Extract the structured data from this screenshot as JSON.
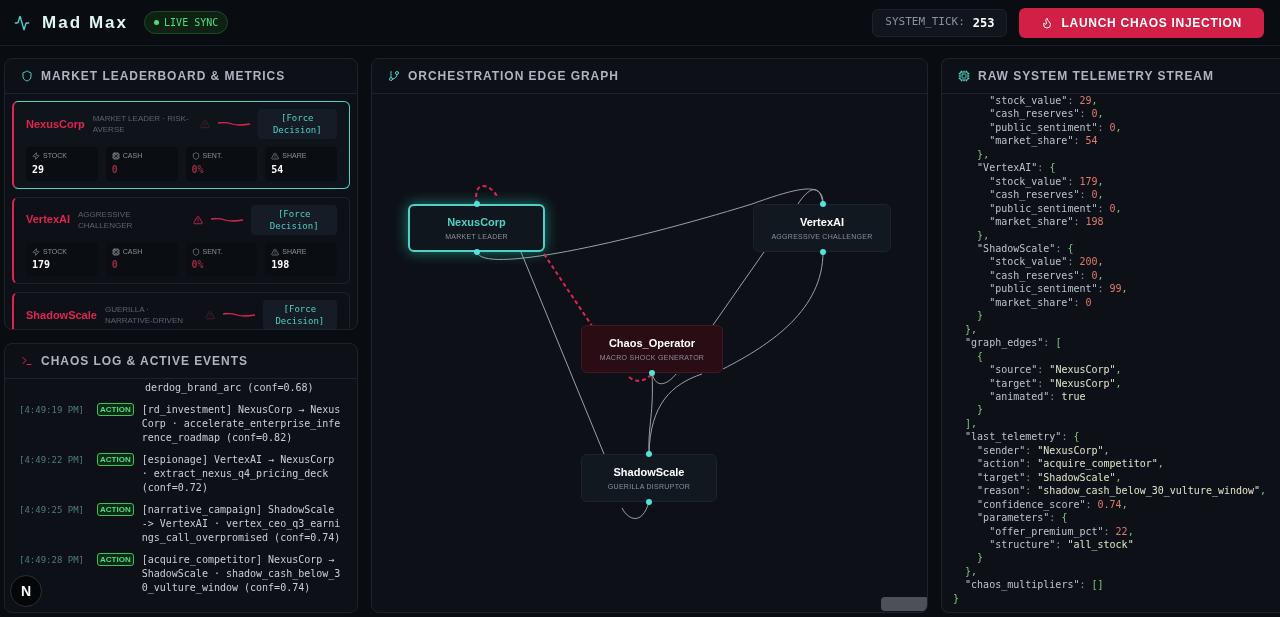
{
  "header": {
    "title": "Mad Max",
    "status": {
      "label": "LIVE SYNC",
      "live": true
    },
    "tick_label": "SYSTEM_TICK:",
    "tick_value": "253",
    "launch_button": "LAUNCH CHAOS INJECTION"
  },
  "leaderboard": {
    "title": "MARKET LEADERBOARD & METRICS",
    "cards": [
      {
        "name": "NexusCorp",
        "subtitle": "MARKET LEADER · RISK-AVERSE",
        "selected": true,
        "warning": false,
        "button": "[Force Decision]",
        "metrics": [
          {
            "kind": "stock",
            "label": "STOCK",
            "value": "29",
            "alert": false
          },
          {
            "kind": "cash",
            "label": "CASH",
            "value": "0",
            "alert": true
          },
          {
            "kind": "sentiment",
            "label": "SENT.",
            "value": "0%",
            "alert": true
          },
          {
            "kind": "share",
            "label": "SHARE",
            "value": "54",
            "alert": false
          }
        ]
      },
      {
        "name": "VertexAI",
        "subtitle": "AGGRESSIVE CHALLENGER",
        "selected": false,
        "warning": true,
        "button": "[Force Decision]",
        "metrics": [
          {
            "kind": "stock",
            "label": "STOCK",
            "value": "179",
            "alert": false
          },
          {
            "kind": "cash",
            "label": "CASH",
            "value": "0",
            "alert": true
          },
          {
            "kind": "sentiment",
            "label": "SENT.",
            "value": "0%",
            "alert": true
          },
          {
            "kind": "share",
            "label": "SHARE",
            "value": "198",
            "alert": false
          }
        ]
      },
      {
        "name": "ShadowScale",
        "subtitle": "GUERILLA · NARRATIVE-DRIVEN",
        "selected": false,
        "warning": false,
        "button": "[Force Decision]"
      }
    ]
  },
  "chaos_log": {
    "title": "CHAOS LOG & ACTIVE EVENTS",
    "entries": [
      {
        "kind": "continuation",
        "message": "derdog_brand_arc (conf=0.68)"
      },
      {
        "kind": "action",
        "time": "[4:49:19 PM]",
        "badge": "ACTION",
        "message": "[rd_investment] NexusCorp → NexusCorp · accelerate_enterprise_inference_roadmap (conf=0.82)"
      },
      {
        "kind": "action",
        "time": "[4:49:22 PM]",
        "badge": "ACTION",
        "message": "[espionage] VertexAI → NexusCorp · extract_nexus_q4_pricing_deck (conf=0.72)"
      },
      {
        "kind": "action",
        "time": "[4:49:25 PM]",
        "badge": "ACTION",
        "message": "[narrative_campaign] ShadowScale -> VertexAI · vertex_ceo_q3_earnings_call_overpromised (conf=0.74)"
      },
      {
        "kind": "action",
        "time": "[4:49:28 PM]",
        "badge": "ACTION",
        "message": "[acquire_competitor] NexusCorp → ShadowScale · shadow_cash_below_30_vulture_window (conf=0.74)"
      }
    ]
  },
  "graph": {
    "title": "ORCHESTRATION EDGE GRAPH",
    "nodes": [
      {
        "kind": "agent",
        "label": "NexusCorp",
        "subtitle": "MARKET LEADER",
        "selected": true
      },
      {
        "kind": "agent",
        "label": "VertexAI",
        "subtitle": "AGGRESSIVE CHALLENGER",
        "selected": false
      },
      {
        "kind": "operator",
        "label": "Chaos_Operator",
        "subtitle": "MACRO SHOCK GENERATOR",
        "selected": false
      },
      {
        "kind": "agent",
        "label": "ShadowScale",
        "subtitle": "GUERILLA DISRUPTOR",
        "selected": false
      }
    ]
  },
  "telemetry": {
    "title": "RAW SYSTEM TELEMETRY STREAM",
    "lines": [
      "      \"stock_value\": 29,",
      "      \"cash_reserves\": 0,",
      "      \"public_sentiment\": 0,",
      "      \"market_share\": 54",
      "    },",
      "    \"VertexAI\": {",
      "      \"stock_value\": 179,",
      "      \"cash_reserves\": 0,",
      "      \"public_sentiment\": 0,",
      "      \"market_share\": 198",
      "    },",
      "    \"ShadowScale\": {",
      "      \"stock_value\": 200,",
      "      \"cash_reserves\": 0,",
      "      \"public_sentiment\": 99,",
      "      \"market_share\": 0",
      "    }",
      "  },",
      "  \"graph_edges\": [",
      "    {",
      "      \"source\": \"NexusCorp\",",
      "      \"target\": \"NexusCorp\",",
      "      \"animated\": true",
      "    }",
      "  ],",
      "  \"last_telemetry\": {",
      "    \"sender\": \"NexusCorp\",",
      "    \"action\": \"acquire_competitor\",",
      "    \"target\": \"ShadowScale\",",
      "    \"reason\": \"shadow_cash_below_30_vulture_window\",",
      "    \"confidence_score\": 0.74,",
      "    \"parameters\": {",
      "      \"offer_premium_pct\": 22,",
      "      \"structure\": \"all_stock\"",
      "    }",
      "  },",
      "  \"chaos_multipliers\": []",
      "}"
    ]
  },
  "dev_indicator": "N"
}
